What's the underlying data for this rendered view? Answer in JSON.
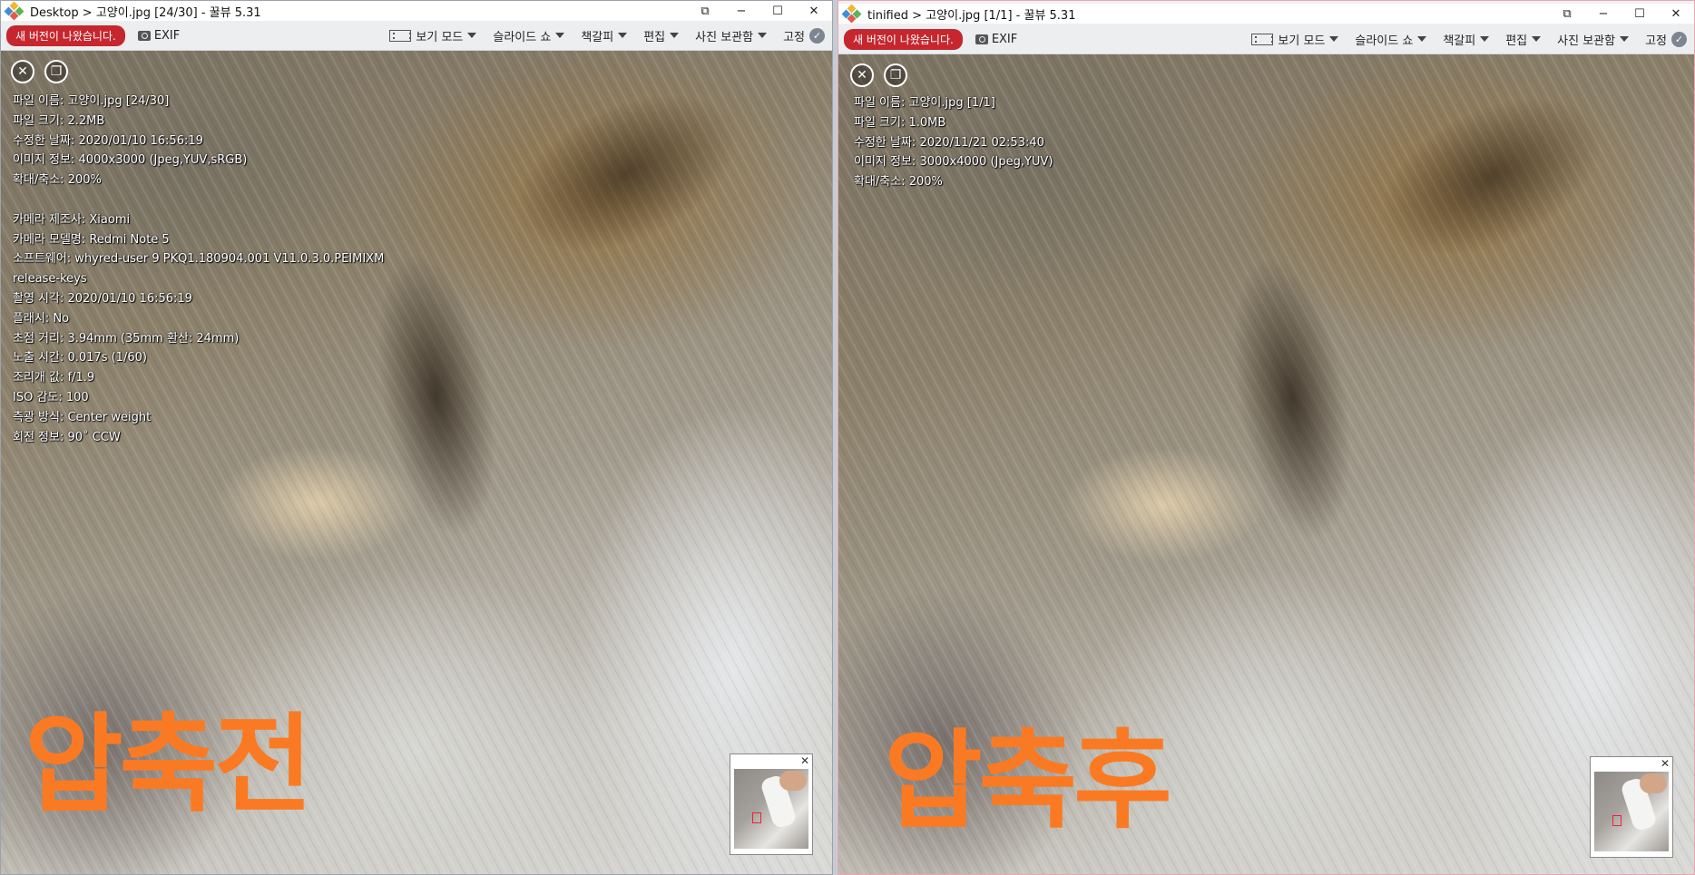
{
  "windows": [
    {
      "id": "left",
      "breadcrumb_folder": "Desktop",
      "breadcrumb_sep": ">",
      "file_title": "고양이.jpg [24/30]",
      "app_suffix": "- 꿀뷰 5.31",
      "new_version": "새 버전이 나왔습니다.",
      "exif": "EXIF",
      "menus": [
        "보기 모드",
        "슬라이드 쇼",
        "책갈피",
        "편집",
        "사진 보관함",
        "고정"
      ],
      "info": [
        "파일 이름: 고양이.jpg [24/30]",
        "파일 크기: 2.2MB",
        "수정한 날짜: 2020/01/10 16:56:19",
        "이미지 정보: 4000x3000 (Jpeg,YUV,sRGB)",
        "확대/축소: 200%",
        "",
        "카메라 제조사: Xiaomi",
        "카메라 모델명: Redmi Note 5",
        "소프트웨어: whyred-user 9 PKQ1.180904.001 V11.0.3.0.PEIMIXM",
        "release-keys",
        "촬영 시각: 2020/01/10 16:56:19",
        "플래시: No",
        "초점 거리: 3.94mm (35mm 환산: 24mm)",
        "노출 시간: 0.017s (1/60)",
        "조리개 값: f/1.9",
        "ISO 감도: 100",
        "측광 방식: Center weight",
        "회전 정보: 90˚ CCW"
      ],
      "caption": "압축전"
    },
    {
      "id": "right",
      "breadcrumb_folder": "tinified",
      "breadcrumb_sep": ">",
      "file_title": "고양이.jpg [1/1]",
      "app_suffix": "- 꿀뷰 5.31",
      "new_version": "새 버전이 나왔습니다.",
      "exif": "EXIF",
      "menus": [
        "보기 모드",
        "슬라이드 쇼",
        "책갈피",
        "편집",
        "사진 보관함",
        "고정"
      ],
      "info": [
        "파일 이름: 고양이.jpg [1/1]",
        "파일 크기: 1.0MB",
        "수정한 날짜: 2020/11/21 02:53:40",
        "이미지 정보: 3000x4000 (Jpeg,YUV)",
        "확대/축소: 200%"
      ],
      "caption": "압축후"
    }
  ],
  "window_controls": {
    "pin": "⧉",
    "minimize": "−",
    "maximize": "☐",
    "close": "✕"
  },
  "overlay_icons": {
    "close": "✕",
    "copy": "❐"
  },
  "thumbnail_close": "✕",
  "colors": {
    "caption": "#fa7a23",
    "new_version_bg": "#c6262e"
  }
}
